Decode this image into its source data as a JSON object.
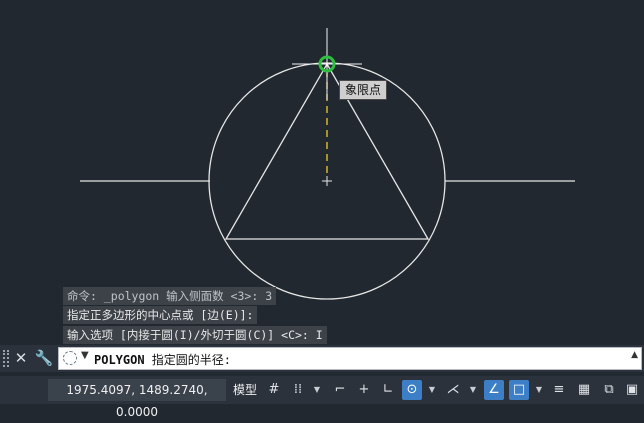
{
  "tooltip": {
    "label": "象限点"
  },
  "history": [
    "命令: _polygon 输入侧面数 <3>: 3",
    "指定正多边形的中心点或 [边(E)]:",
    "输入选项 [内接于圆(I)/外切于圆(C)] <C>: I"
  ],
  "command": {
    "name": "POLYGON",
    "prompt": " 指定圆的半径:"
  },
  "status": {
    "coordinates": "1975.4097, 1489.2740, 0.0000",
    "model_label": "模型"
  },
  "colors": {
    "canvas_bg": "#212830",
    "geometry": "#e6e6e6",
    "snap_marker": "#2fbf3f",
    "tracking_line": "#e8c020",
    "active_toggle": "#3c7fc6"
  },
  "icons": {
    "close": "close-icon",
    "customize": "wrench-icon",
    "grid": "grid-icon",
    "snap": "snap-icon",
    "polar": "polar-icon",
    "osnap": "object-snap-icon"
  }
}
